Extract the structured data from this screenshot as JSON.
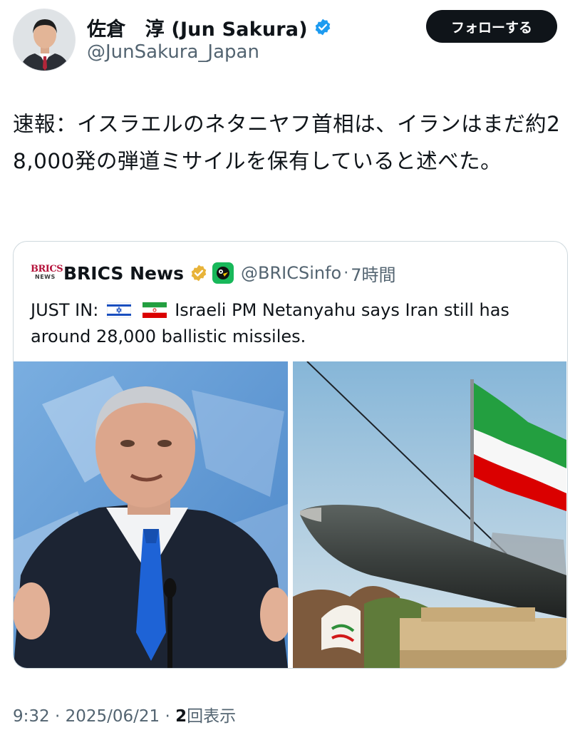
{
  "author": {
    "display_name": "佐倉　淳 (Jun Sakura)",
    "handle": "@JunSakura_Japan",
    "verified_color": "#1d9bf0"
  },
  "follow_button": {
    "label": "フォローする"
  },
  "tweet": {
    "text": "速報：イスラエルのネタニヤフ首相は、イランはまだ約28,000発の弾道ミサイルを保有していると述べた。"
  },
  "quote": {
    "logo_text_top": "BRICS",
    "logo_text_bottom": "NEWS",
    "name": "BRICS News",
    "handle": "@BRICSinfo",
    "separator": "·",
    "time": "7時間",
    "text_prefix": "JUST IN:",
    "text_body": "Israeli PM Netanyahu says Iran still has around 28,000 ballistic missiles.",
    "flags": [
      "israel-flag-icon",
      "iran-flag-icon"
    ],
    "badge_color": "#e8b339",
    "affiliate_color": "#18b85a"
  },
  "meta": {
    "time": "9:32",
    "sep1": " · ",
    "date": "2025/06/21",
    "sep2": " · ",
    "views_count": "2",
    "views_label": "回表示"
  }
}
